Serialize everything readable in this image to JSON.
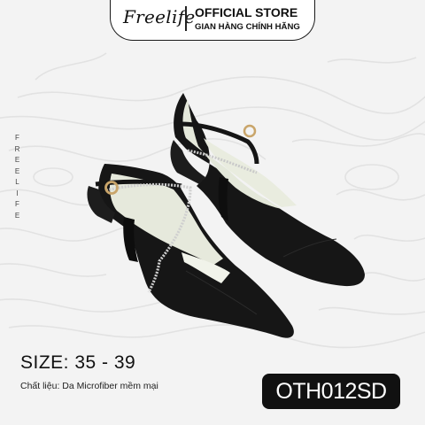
{
  "header": {
    "brand": "Freelife",
    "store_title": "OFFICIAL STORE",
    "store_subtitle": "GIAN HÀNG CHÍNH HÃNG"
  },
  "side_text": [
    "F",
    "R",
    "E",
    "E",
    "L",
    "I",
    "F",
    "E"
  ],
  "product": {
    "size": "SIZE: 35 - 39",
    "material": "Chất liệu: Da Microfiber mềm mại",
    "code": "OTH012SD"
  },
  "colors": {
    "background": "#f3f3f3",
    "shoe": "#151515",
    "lining": "#e8ebdf",
    "code_badge": "#111111"
  }
}
